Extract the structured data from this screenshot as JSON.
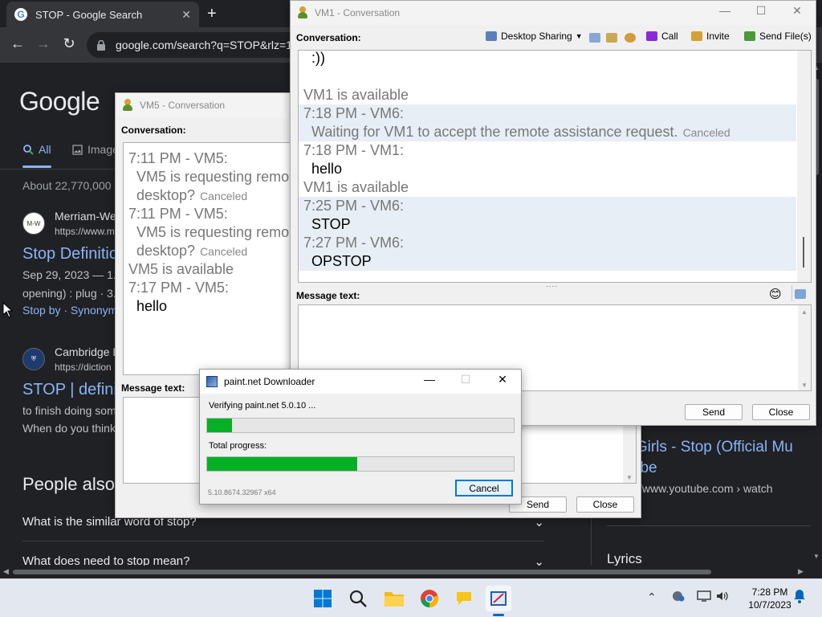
{
  "browser": {
    "tab_title": "STOP - Google Search",
    "url": "google.com/search?q=STOP&rlz=1",
    "google_logo": "Google",
    "search_tabs": [
      {
        "label": "All"
      },
      {
        "label": "Images"
      }
    ],
    "about_text": "About 22,770,000",
    "results": [
      {
        "site": "Merriam-We",
        "url": "https://www.m",
        "title": "Stop Definitio",
        "snippet1": "Sep 29, 2023 — 1. a",
        "snippet2": "opening) : plug · 3.",
        "link": "Stop by · Synonym"
      },
      {
        "site": "Cambridge D",
        "url": "https://diction",
        "title": "STOP | defini",
        "snippet1": "to finish doing som",
        "snippet2": "When do you think"
      }
    ],
    "people_also_ask": "People also",
    "questions": [
      "What is the similar word of stop?",
      "What does need to stop mean?"
    ],
    "right_result_title": "e Girls - Stop (Official Mu\nTube",
    "right_result_url": "/www.youtube.com › watch",
    "right_lyrics": "Lyrics"
  },
  "vm5": {
    "title": "VM5 - Conversation",
    "conversation_label": "Conversation:",
    "message_label": "Message text:",
    "lines": [
      {
        "kind": "hdr",
        "text": "7:11 PM - VM5:"
      },
      {
        "kind": "body-grey",
        "text": "VM5 is requesting remo"
      },
      {
        "kind": "body-grey",
        "text": "desktop?",
        "note": "Canceled"
      },
      {
        "kind": "hdr",
        "text": "7:11 PM - VM5:"
      },
      {
        "kind": "body-grey",
        "text": "VM5 is requesting remo"
      },
      {
        "kind": "body-grey",
        "text": "desktop?",
        "note": "Canceled"
      },
      {
        "kind": "sys",
        "text": "VM5 is available"
      },
      {
        "kind": "hdr",
        "text": "7:17 PM - VM5:"
      },
      {
        "kind": "body-text",
        "text": "hello"
      }
    ],
    "send_label": "Send",
    "close_label": "Close"
  },
  "vm1": {
    "title": "VM1 - Conversation",
    "conversation_label": "Conversation:",
    "message_label": "Message text:",
    "toolbar": {
      "desktop_sharing": "Desktop Sharing",
      "call": "Call",
      "invite": "Invite",
      "send_files": "Send File(s)"
    },
    "lines": [
      {
        "kind": "body-text",
        "text": ":))",
        "shade": false
      },
      {
        "kind": "blank",
        "text": "",
        "shade": false
      },
      {
        "kind": "sys",
        "text": "VM1 is available",
        "shade": false
      },
      {
        "kind": "hdr",
        "text": "7:18 PM - VM6:",
        "shade": true
      },
      {
        "kind": "body-grey",
        "text": "Waiting for VM1 to accept the remote assistance request.",
        "note": "Canceled",
        "shade": true
      },
      {
        "kind": "hdr",
        "text": "7:18 PM - VM1:",
        "shade": false
      },
      {
        "kind": "body-text",
        "text": "hello",
        "shade": false
      },
      {
        "kind": "sys",
        "text": "VM1 is available",
        "shade": false
      },
      {
        "kind": "hdr",
        "text": "7:25 PM - VM6:",
        "shade": true
      },
      {
        "kind": "body-text",
        "text": "STOP",
        "shade": true
      },
      {
        "kind": "hdr",
        "text": "7:27 PM - VM6:",
        "shade": true
      },
      {
        "kind": "body-text",
        "text": "OPSTOP",
        "shade": true
      }
    ],
    "splitter": "....",
    "send_label": "Send",
    "close_label": "Close"
  },
  "downloader": {
    "title": "paint.net Downloader",
    "verifying_text": "Verifying paint.net 5.0.10 ...",
    "file_progress": 0.08,
    "total_label": "Total progress:",
    "total_progress": 0.49,
    "version": "5.10.8674.32967 x64",
    "cancel_label": "Cancel"
  },
  "taskbar": {
    "time": "7:28 PM",
    "date": "10/7/2023"
  },
  "colors": {
    "progress_green": "#06b025",
    "chrome_bg": "#202124",
    "link_blue": "#8ab4f8"
  }
}
